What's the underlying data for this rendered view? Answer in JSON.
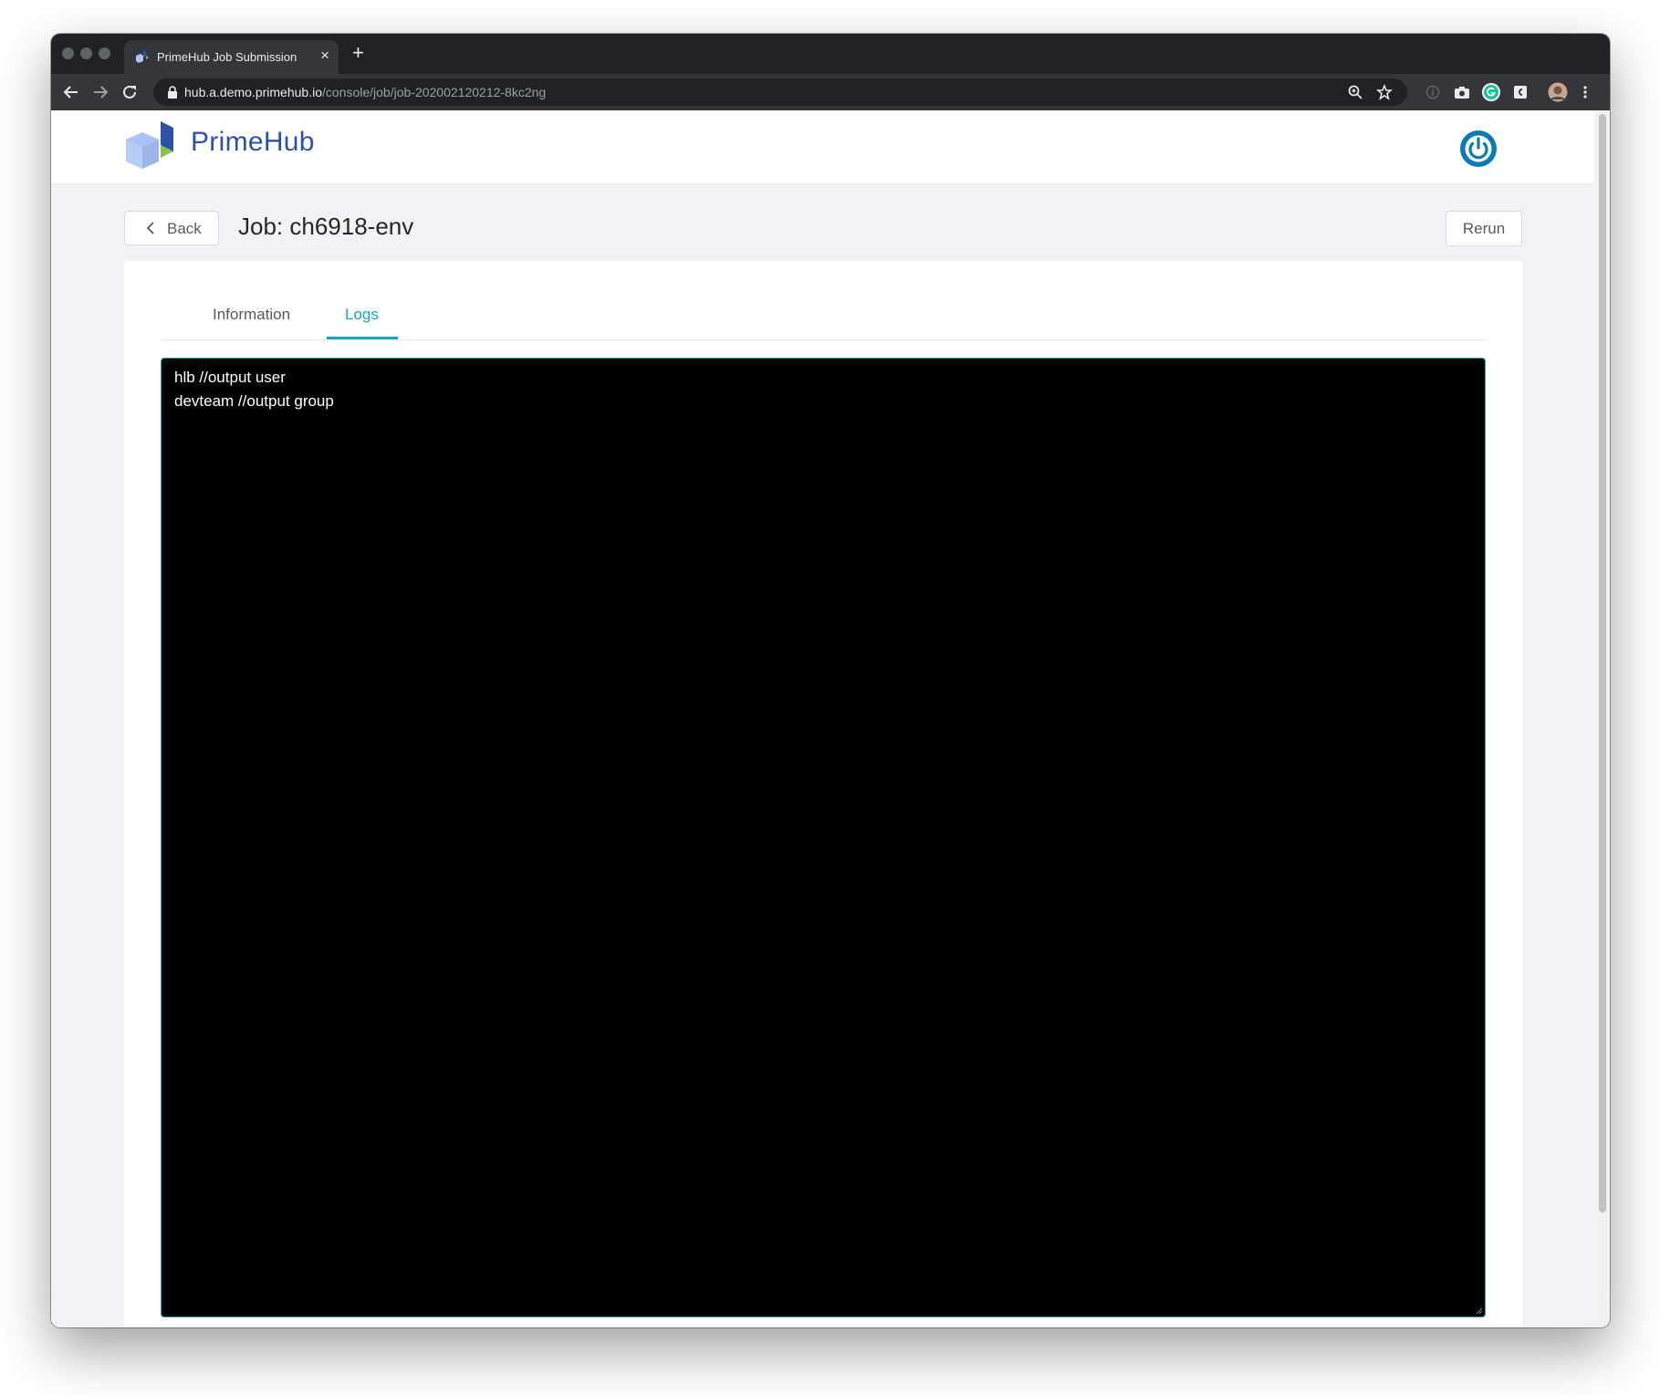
{
  "browser": {
    "tab_title": "PrimeHub Job Submission",
    "tab_close": "×",
    "new_tab": "+",
    "url_host": "hub.a.demo.primehub.io",
    "url_path": "/console/job/job-202002120212-8kc2ng",
    "icons": [
      "back-arrow-icon",
      "forward-arrow-icon",
      "reload-icon",
      "lock-icon",
      "zoom-icon",
      "bookmark-star-icon",
      "info-icon",
      "camera-icon",
      "grammarly-icon",
      "extension-icon",
      "profile-avatar-icon",
      "more-menu-icon"
    ]
  },
  "header": {
    "logo_text": "PrimeHub",
    "brand_color": "#2d50a8",
    "power_icon_color": "#0a7bb5"
  },
  "job": {
    "back_label": "Back",
    "title": "Job: ch6918-env",
    "rerun_label": "Rerun"
  },
  "tabs": {
    "items": [
      {
        "label": "Information",
        "active": false
      },
      {
        "label": "Logs",
        "active": true
      }
    ],
    "accent_color": "#13a8b8"
  },
  "logs": {
    "lines": [
      "hlb //output user",
      "devteam //output group"
    ]
  }
}
